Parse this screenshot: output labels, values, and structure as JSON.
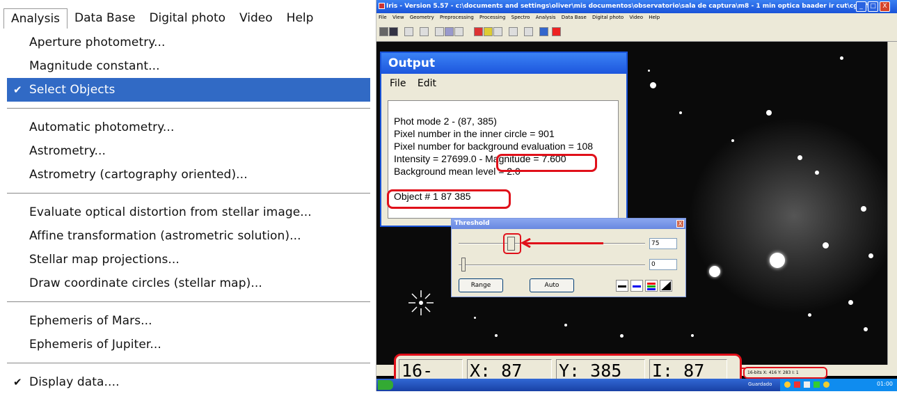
{
  "menu": {
    "bar": [
      "Analysis",
      "Data Base",
      "Digital photo",
      "Video",
      "Help"
    ],
    "groups": [
      [
        {
          "label": "Aperture photometry...",
          "checked": false,
          "selected": false
        },
        {
          "label": "Magnitude constant...",
          "checked": false,
          "selected": false
        },
        {
          "label": "Select Objects",
          "checked": true,
          "selected": true
        }
      ],
      [
        {
          "label": "Automatic photometry...",
          "checked": false,
          "selected": false
        },
        {
          "label": "Astrometry...",
          "checked": false,
          "selected": false
        },
        {
          "label": "Astrometry (cartography oriented)...",
          "checked": false,
          "selected": false
        }
      ],
      [
        {
          "label": "Evaluate optical distortion from stellar image...",
          "checked": false,
          "selected": false
        },
        {
          "label": "Affine transformation (astrometric solution)...",
          "checked": false,
          "selected": false
        },
        {
          "label": "Stellar map projections...",
          "checked": false,
          "selected": false
        },
        {
          "label": "Draw coordinate circles (stellar map)...",
          "checked": false,
          "selected": false
        }
      ],
      [
        {
          "label": "Ephemeris of Mars...",
          "checked": false,
          "selected": false
        },
        {
          "label": "Ephemeris of Jupiter...",
          "checked": false,
          "selected": false
        }
      ],
      [
        {
          "label": "Display data....",
          "checked": true,
          "selected": false
        }
      ]
    ],
    "check_glyph": "✔",
    "selection_color": "#316ac5"
  },
  "window": {
    "title": "Iris - Version 5.57 - c:\\documents and settings\\oliver\\mis documentos\\observatorio\\sala de captura\\m8 - 1 min optica baader ir cut\\cg1.fit",
    "menubar": [
      "File",
      "View",
      "Geometry",
      "Preprocessing",
      "Processing",
      "Spectro",
      "Analysis",
      "Data Base",
      "Digital photo",
      "Video",
      "Help"
    ],
    "controls": {
      "minimize": "_",
      "maximize": "□",
      "close": "X"
    }
  },
  "output": {
    "title": "Output",
    "menu": [
      "File",
      "Edit"
    ],
    "lines": [
      "Phot mode 2  -  (87,    385)",
      "Pixel number in the inner circle = 901",
      "Pixel number for background evaluation = 108",
      "Intensity = 27699.0  -  Magnitude = 7.600",
      "Background mean level = 2.0",
      "",
      "Object # 1    87     385"
    ]
  },
  "threshold": {
    "title": "Threshold",
    "close": "X",
    "high_value": "75",
    "low_value": "0",
    "range_button": "Range",
    "auto_button": "Auto"
  },
  "status": {
    "bits": "16-bits",
    "x": "X: 87",
    "y": "Y: 385",
    "i": "I: 87",
    "small": "16-bits X: 416   Y: 283   I: 1"
  },
  "taskbar": {
    "item": "Guardado",
    "clock": "01:00"
  },
  "accent_color": "#e0101a"
}
